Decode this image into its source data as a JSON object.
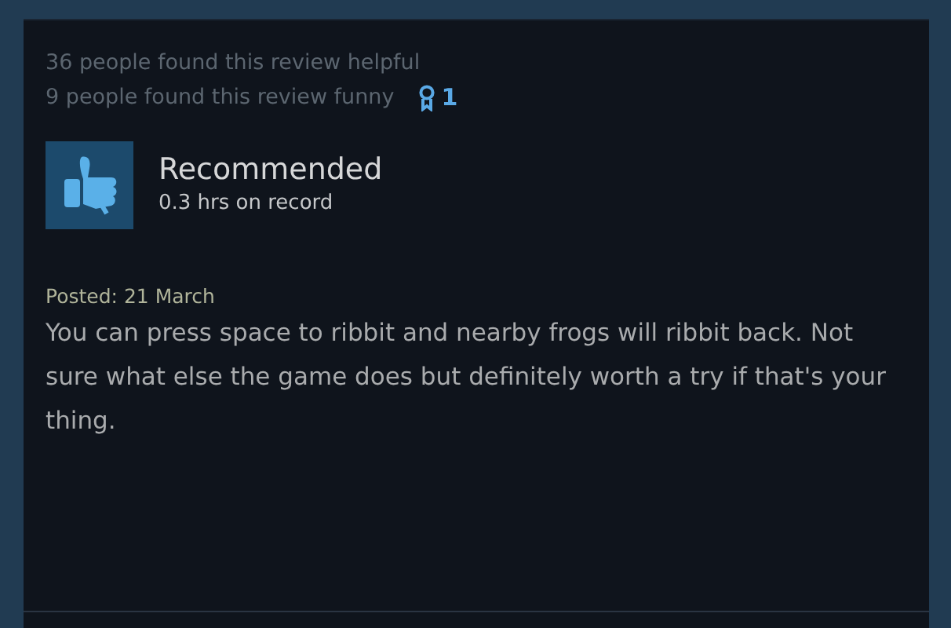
{
  "helpful": "36 people found this review helpful",
  "funny": "9 people found this review funny",
  "award_count": "1",
  "recommendation": {
    "title": "Recommended",
    "kind": "positive",
    "hours": "0.3 hrs on record"
  },
  "posted": "Posted: 21 March",
  "review_text": "You can press space to ribbit and nearby frogs will ribbit back. Not sure what else the game does but definitely worth a try if that's your thing."
}
